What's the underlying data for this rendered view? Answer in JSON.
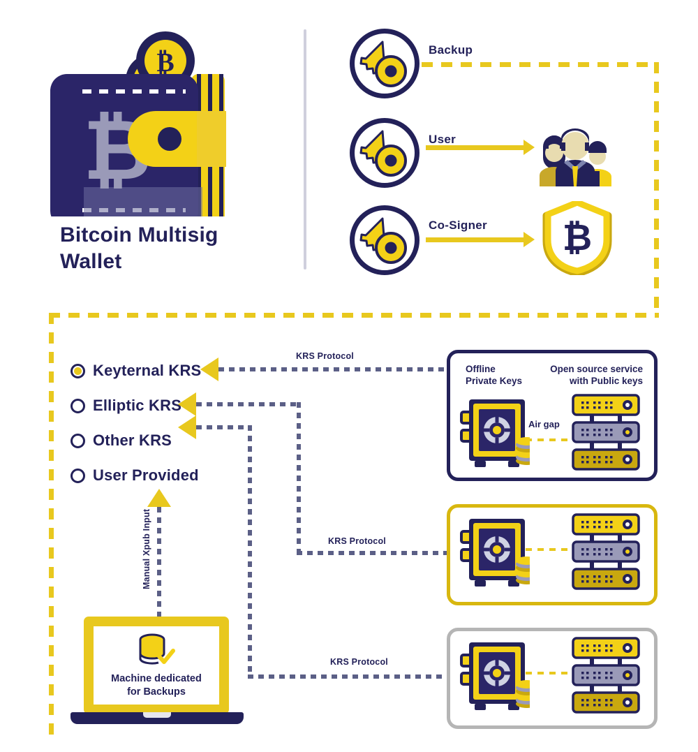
{
  "title": {
    "line1": "Bitcoin Multisig",
    "line2": "Wallet",
    "full": "Bitcoin Multisig Wallet"
  },
  "colors": {
    "navy": "#232159",
    "yellow": "#f3d117",
    "yellow_dark": "#c9a80f",
    "gray_blue": "#9a9ab8",
    "gray_border": "#b5b5b5",
    "dash_gray": "#5b5f86",
    "beige": "#e8dcb0"
  },
  "keys": [
    {
      "icon": "key-icon",
      "label": "Backup",
      "target": null
    },
    {
      "icon": "key-icon",
      "label": "User",
      "target": "users-group-icon"
    },
    {
      "icon": "key-icon",
      "label": "Co-Signer",
      "target": "bitcoin-shield-icon"
    }
  ],
  "krs_options": [
    {
      "label": "Keyternal KRS",
      "selected": true
    },
    {
      "label": "Elliptic KRS",
      "selected": false
    },
    {
      "label": "Other KRS",
      "selected": false
    },
    {
      "label": "User Provided",
      "selected": false
    }
  ],
  "connectors": {
    "krs_protocol_1": "KRS Protocol",
    "krs_protocol_2": "KRS Protocol",
    "krs_protocol_3": "KRS Protocol",
    "manual_xpub": "Manual Xpub Input",
    "air_gap": "Air gap"
  },
  "panels": [
    {
      "border": "navy",
      "header_left": "Offline\nPrivate Keys",
      "header_left_l1": "Offline",
      "header_left_l2": "Private Keys",
      "header_right_l1": "Open source service",
      "header_right_l2": "with Public keys",
      "has_headers": true,
      "air_gap_label": "Air gap",
      "safe": "safe-icon",
      "servers": "server-rack-icon"
    },
    {
      "border": "yellow",
      "has_headers": false,
      "safe": "safe-icon",
      "servers": "server-rack-icon"
    },
    {
      "border": "gray",
      "has_headers": false,
      "safe": "safe-icon",
      "servers": "server-rack-icon"
    }
  ],
  "laptop": {
    "icon": "database-check-icon",
    "line1": "Machine dedicated",
    "line2": "for Backups"
  }
}
